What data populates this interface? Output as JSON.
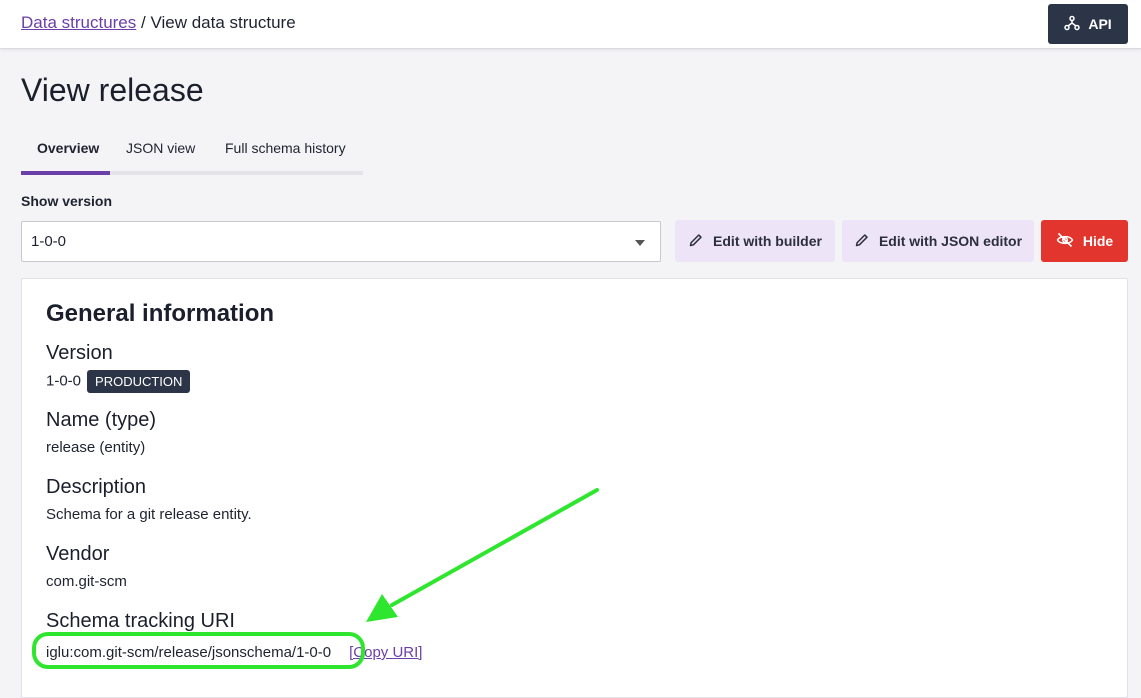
{
  "breadcrumb": {
    "root": "Data structures",
    "separator": " / ",
    "current": "View data structure"
  },
  "header": {
    "api_label": "API"
  },
  "page": {
    "title": "View release"
  },
  "tabs": [
    {
      "label": "Overview",
      "active": true
    },
    {
      "label": "JSON view",
      "active": false
    },
    {
      "label": "Full schema history",
      "active": false
    }
  ],
  "version_picker": {
    "label": "Show version",
    "selected": "1-0-0"
  },
  "actions": {
    "edit_builder": "Edit with builder",
    "edit_json": "Edit with JSON editor",
    "hide": "Hide"
  },
  "general": {
    "title": "General information",
    "version_label": "Version",
    "version_value": "1-0-0",
    "version_badge": "PRODUCTION",
    "name_label": "Name (type)",
    "name_value": "release (entity)",
    "description_label": "Description",
    "description_value": "Schema for a git release entity.",
    "vendor_label": "Vendor",
    "vendor_value": "com.git-scm",
    "uri_label": "Schema tracking URI",
    "uri_value": "iglu:com.git-scm/release/jsonschema/1-0-0",
    "copy_uri": "[Copy URI]"
  },
  "colors": {
    "accent": "#6b3fa8",
    "dark_button": "#2c3448",
    "danger": "#e1352d",
    "annotation": "#2ee62e"
  }
}
